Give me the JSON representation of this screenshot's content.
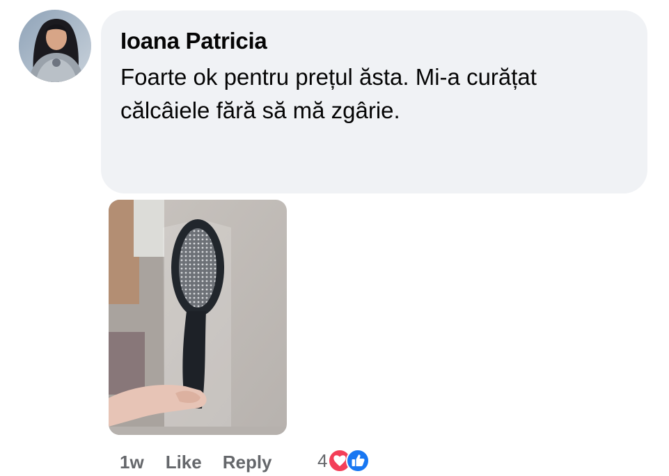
{
  "comment": {
    "author": "Ioana Patricia",
    "text": "Foarte ok pentru prețul ăsta. Mi-a curățat călcâiele fără să mă zgârie.",
    "avatar_icon": "user-avatar-photo",
    "photo_icon": "foot-file-photo"
  },
  "actions": {
    "time": "1w",
    "like_label": "Like",
    "reply_label": "Reply"
  },
  "reactions": {
    "count": "4",
    "types": [
      "love-reaction-icon",
      "like-reaction-icon"
    ],
    "colors": {
      "love": "#f33e58",
      "like": "#1877f2"
    }
  },
  "colors": {
    "bubble_bg": "#f0f2f5",
    "author_text": "#050505",
    "meta_text": "#65676b"
  }
}
